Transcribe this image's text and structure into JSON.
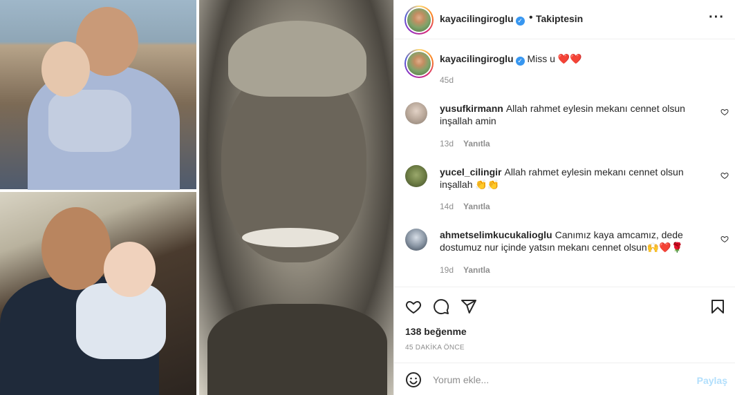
{
  "header": {
    "username": "kayacilingiroglu",
    "verified_icon": "verified-badge-icon",
    "separator": "•",
    "follow_status": "Takiptesin",
    "more_icon": "more-options-icon"
  },
  "caption": {
    "username": "kayacilingiroglu",
    "text": "Miss u",
    "emoji": "❤️❤️",
    "time": "45d"
  },
  "comments": [
    {
      "username": "yusufkirmann",
      "text": "Allah rahmet eylesin mekanı cennet olsun inşallah amin",
      "time": "13d",
      "reply_label": "Yanıtla"
    },
    {
      "username": "yucel_cilingir",
      "text": "Allah rahmet eylesin mekanı cennet olsun inşallah 👏👏",
      "time": "14d",
      "reply_label": "Yanıtla"
    },
    {
      "username": "ahmetselimkucukalioglu",
      "text": "Canımız kaya amcamız, dede dostumuz nur içinde yatsın mekanı cennet olsun🙌❤️🌹",
      "time": "19d",
      "reply_label": "Yanıtla"
    }
  ],
  "actions": {
    "like_icon": "heart-icon",
    "comment_icon": "comment-icon",
    "share_icon": "share-icon",
    "save_icon": "bookmark-icon",
    "likes": "138 beğenme",
    "time_ago": "45 DAKİKA ÖNCE"
  },
  "composer": {
    "emoji_icon": "emoji-icon",
    "placeholder": "Yorum ekle...",
    "post_label": "Paylaş"
  },
  "colors": {
    "verified": "#3897f0",
    "heart": "#e0245e",
    "post_disabled": "#b2dffc",
    "secondary_text": "#8e8e8e"
  }
}
